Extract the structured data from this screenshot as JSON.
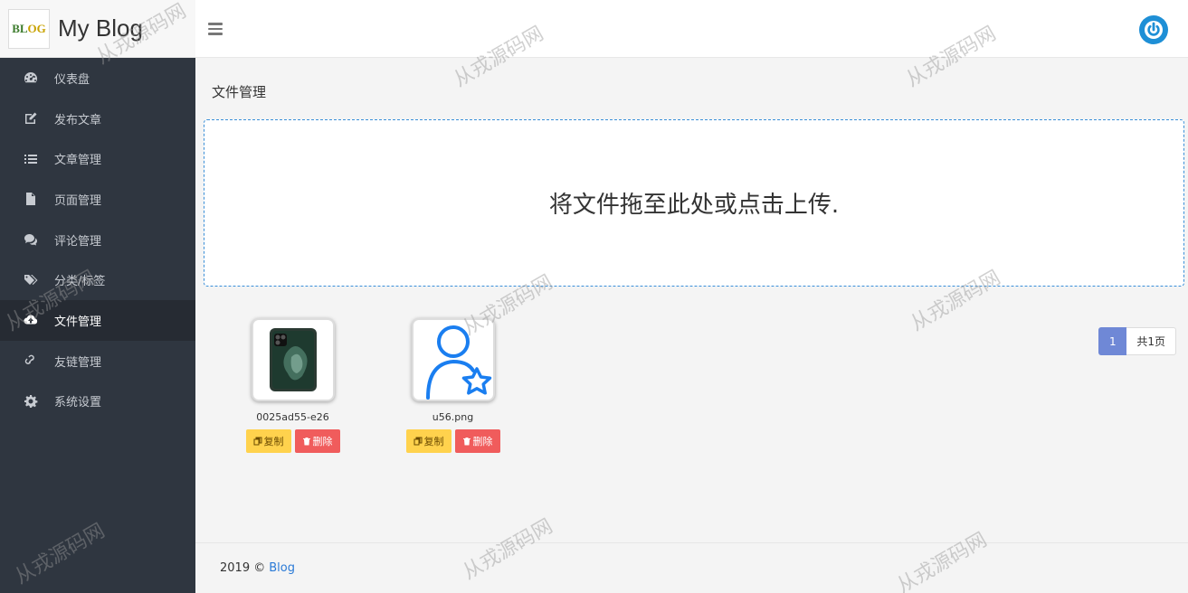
{
  "brand": {
    "title": "My Blog",
    "logo_text_a": "BL",
    "logo_text_b": "OG"
  },
  "sidebar": {
    "items": [
      {
        "label": "仪表盘",
        "icon": "dashboard-icon"
      },
      {
        "label": "发布文章",
        "icon": "edit-icon"
      },
      {
        "label": "文章管理",
        "icon": "list-icon"
      },
      {
        "label": "页面管理",
        "icon": "file-icon"
      },
      {
        "label": "评论管理",
        "icon": "comments-icon"
      },
      {
        "label": "分类/标签",
        "icon": "tags-icon"
      },
      {
        "label": "文件管理",
        "icon": "cloud-upload-icon",
        "active": true
      },
      {
        "label": "友链管理",
        "icon": "link-icon"
      },
      {
        "label": "系统设置",
        "icon": "gear-icon"
      }
    ]
  },
  "header": {
    "menu_icon": "hamburger-icon",
    "logout_icon": "power-icon"
  },
  "main": {
    "title": "文件管理",
    "dropzone_text": "将文件拖至此处或点击上传.",
    "files": [
      {
        "name": "0025ad55-e26",
        "thumb": "phone-image"
      },
      {
        "name": "u56.png",
        "thumb": "user-star-icon"
      }
    ],
    "copy_label": "复制",
    "delete_label": "删除",
    "pagination": {
      "current": "1",
      "total": "共1页"
    }
  },
  "footer": {
    "text": "2019 ©",
    "link": "Blog"
  },
  "watermark": "从戎源码网",
  "colors": {
    "sidebar": "#2f3640",
    "accent": "#1e8fd6",
    "copy": "#ffd24d",
    "delete": "#f05c5c",
    "pager": "#6f88d6"
  }
}
